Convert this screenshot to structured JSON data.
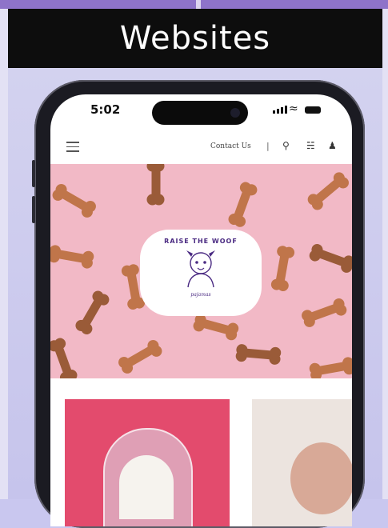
{
  "banner": {
    "title": "Websites"
  },
  "status_bar": {
    "time": "5:02"
  },
  "store_nav": {
    "contact_label": "Contact Us",
    "separator": "|",
    "icons": [
      "menu-icon",
      "search-icon",
      "cart-icon",
      "account-icon"
    ]
  },
  "hero": {
    "logo_text": "RAISE THE WOOF",
    "logo_subtext": "pajamas"
  },
  "colors": {
    "banner_bg": "#0d0d0d",
    "accent": "#8e73c9",
    "hero_pink": "#f2b9c6",
    "product_red": "#e34b6d"
  }
}
